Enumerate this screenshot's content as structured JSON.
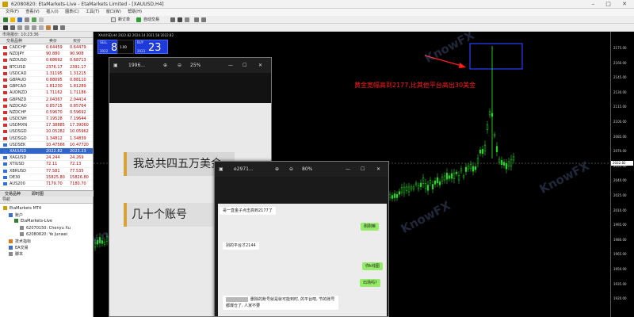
{
  "window": {
    "title": "62080820: EtaMarkets-Live - EtaMarkets Limited - [XAUUSD,H4]",
    "controls": "– □ ✕"
  },
  "menu": [
    "文件(F)",
    "查看(V)",
    "插入(I)",
    "图表(C)",
    "工具(T)",
    "窗口(W)",
    "帮助(H)"
  ],
  "toolbar": {
    "new_order_label": "新订单",
    "auto_trading_label": "自动交易"
  },
  "market_watch": {
    "title": "市场报价: 10:23:36",
    "columns": [
      "交易品种",
      "卖价",
      "买价"
    ],
    "rows": [
      {
        "symbol": "CADCHF",
        "bid": "0.64459",
        "ask": "0.64479",
        "dir": "down"
      },
      {
        "symbol": "NZDJPY",
        "bid": "90.880",
        "ask": "90.908",
        "dir": "down"
      },
      {
        "symbol": "NZDUSD",
        "bid": "0.68692",
        "ask": "0.68713",
        "dir": "down"
      },
      {
        "symbol": "BTCUSD",
        "bid": "2376.17",
        "ask": "2391.17",
        "dir": "down"
      },
      {
        "symbol": "USDCAD",
        "bid": "1.31195",
        "ask": "1.31215",
        "dir": "down"
      },
      {
        "symbol": "GBPAUD",
        "bid": "0.88095",
        "ask": "0.88110",
        "dir": "down"
      },
      {
        "symbol": "GBPCAD",
        "bid": "1.81230",
        "ask": "1.81289",
        "dir": "down"
      },
      {
        "symbol": "AUDNZD",
        "bid": "1.71162",
        "ask": "1.71186",
        "dir": "down"
      },
      {
        "symbol": "GBPNZD",
        "bid": "2.04367",
        "ask": "2.04414",
        "dir": "down"
      },
      {
        "symbol": "NZDCAD",
        "bid": "0.85715",
        "ask": "0.85764",
        "dir": "down"
      },
      {
        "symbol": "NZDCHF",
        "bid": "0.59670",
        "ask": "0.59692",
        "dir": "down"
      },
      {
        "symbol": "USDCNH",
        "bid": "7.19528",
        "ask": "7.19644",
        "dir": "down"
      },
      {
        "symbol": "USDMXN",
        "bid": "17.38885",
        "ask": "17.39060",
        "dir": "down"
      },
      {
        "symbol": "USDSGD",
        "bid": "10.05282",
        "ask": "10.05962",
        "dir": "down"
      },
      {
        "symbol": "USDSGD",
        "bid": "1.34812",
        "ask": "1.34839",
        "dir": "down"
      },
      {
        "symbol": "USDSEK",
        "bid": "10.47566",
        "ask": "10.47720",
        "dir": "up"
      },
      {
        "symbol": "XAUUSD",
        "bid": "2022.82",
        "ask": "2023.23",
        "dir": "up",
        "selected": true
      },
      {
        "symbol": "XAGUSD",
        "bid": "24.244",
        "ask": "24.269",
        "dir": "up"
      },
      {
        "symbol": "XTIUSD",
        "bid": "72.11",
        "ask": "72.13",
        "dir": "up"
      },
      {
        "symbol": "XBRUSD",
        "bid": "77.581",
        "ask": "77.535",
        "dir": "up"
      },
      {
        "symbol": "DE30",
        "bid": "15825.80",
        "ask": "15826.80",
        "dir": "up"
      },
      {
        "symbol": "AUS200",
        "bid": "7179.70",
        "ask": "7180.70",
        "dir": "up"
      }
    ],
    "tabs": [
      "交易品种",
      "即时图"
    ]
  },
  "navigator": {
    "title": "导航",
    "items": [
      {
        "label": "EtaMarkets MT4",
        "indent": 0
      },
      {
        "label": "账户",
        "indent": 1
      },
      {
        "label": "EtaMarkets-Live",
        "indent": 2
      },
      {
        "label": "62070150: Chenyu Xu",
        "indent": 3
      },
      {
        "label": "62080820: Ye Junwei",
        "indent": 3
      },
      {
        "label": "技术指标",
        "indent": 1
      },
      {
        "label": "EA交易",
        "indent": 1
      },
      {
        "label": "脚本",
        "indent": 1
      }
    ]
  },
  "chart": {
    "info": "XAUUSD,H4 2022.82 2024.14 2021.58 2022.82",
    "sell_panel": {
      "label": "SELL",
      "lots": "1.00",
      "big": "82",
      "prefix": "2022",
      "sub": "2022"
    },
    "buy_panel": {
      "label": "BUY",
      "big": "23",
      "prefix": "2023",
      "sub": "2023",
      "suffix": ""
    },
    "annotation": "黄金宽幅高到2177,比其他平台高出30美金",
    "price_axis": [
      "2175.00",
      "2160.00",
      "2145.00",
      "2130.00",
      "2115.00",
      "2100.00",
      "2085.00",
      "2070.00",
      "2055.00",
      "2040.00",
      "2025.00",
      "2010.00",
      "1995.00",
      "1980.00",
      "1965.00",
      "1950.00",
      "1935.00",
      "1920.00"
    ],
    "current_price": "2022.82",
    "watermark": "KnowFX"
  },
  "viewer1": {
    "title": "1996...",
    "zoom": "25%",
    "text1": "我总共四五万美金",
    "text2": "几十个账号"
  },
  "viewer2": {
    "title": "e2971...",
    "zoom": "80%",
    "messages": [
      {
        "side": "left",
        "text": "哥一直金子点击高到2177了"
      },
      {
        "side": "right",
        "text": "刚刚嘛"
      },
      {
        "side": "left",
        "text": "别的平台才2144"
      },
      {
        "side": "right",
        "text": "你k线图"
      },
      {
        "side": "right",
        "text": "出场吗?"
      },
      {
        "side": "left",
        "text": "删除的账号就是就可能到时, 的平台吧, 节的账号都爆仓了, 人家不要"
      }
    ]
  }
}
